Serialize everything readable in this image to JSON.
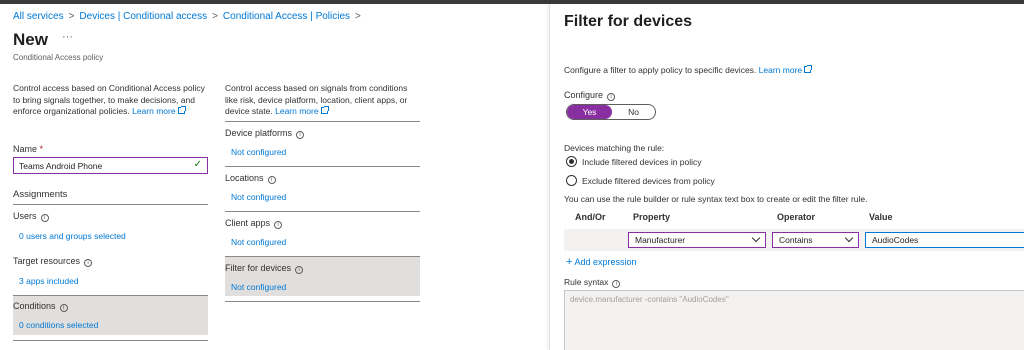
{
  "breadcrumb": {
    "items": [
      "All services",
      "Devices | Conditional access",
      "Conditional Access | Policies"
    ],
    "separator": ">"
  },
  "page": {
    "title": "New",
    "more_icon": "ellipsis-icon",
    "subtitle": "Conditional Access policy"
  },
  "left_column": {
    "description": "Control access based on Conditional Access policy to bring signals together, to make decisions, and enforce organizational policies.",
    "learn_more": "Learn more",
    "name_label": "Name",
    "required_marker": "*",
    "name_value": "Teams Android Phone",
    "assignments_heading": "Assignments",
    "users_label": "Users",
    "users_value": "0 users and groups selected",
    "target_label": "Target resources",
    "target_value": "3 apps included",
    "conditions_label": "Conditions",
    "conditions_value": "0 conditions selected"
  },
  "middle_column": {
    "description": "Control access based on signals from conditions like risk, device platform, location, client apps, or device state.",
    "learn_more": "Learn more",
    "device_platforms_label": "Device platforms",
    "device_platforms_value": "Not configured",
    "locations_label": "Locations",
    "locations_value": "Not configured",
    "client_apps_label": "Client apps",
    "client_apps_value": "Not configured",
    "filter_label": "Filter for devices",
    "filter_value": "Not configured"
  },
  "panel": {
    "title": "Filter for devices",
    "intro": "Configure a filter to apply policy to specific devices.",
    "learn_more": "Learn more",
    "configure_label": "Configure",
    "toggle_yes": "Yes",
    "toggle_no": "No",
    "toggle_selected": "Yes",
    "devices_matching_label": "Devices matching the rule:",
    "radio_include": "Include filtered devices in policy",
    "radio_exclude": "Exclude filtered devices from policy",
    "radio_selected": "include",
    "builder_hint": "You can use the rule builder or rule syntax text box to create or edit the filter rule.",
    "col_andor": "And/Or",
    "col_property": "Property",
    "col_operator": "Operator",
    "col_value": "Value",
    "property_value": "Manufacturer",
    "operator_value": "Contains",
    "value_value": "AudioCodes",
    "add_expression": "Add expression",
    "rule_syntax_label": "Rule syntax",
    "rule_syntax_value": "device.manufacturer -contains \"AudioCodes\""
  },
  "colors": {
    "accent": "#8a2fa2",
    "link": "#0078d4",
    "selected_row": "#e1dfdd"
  }
}
